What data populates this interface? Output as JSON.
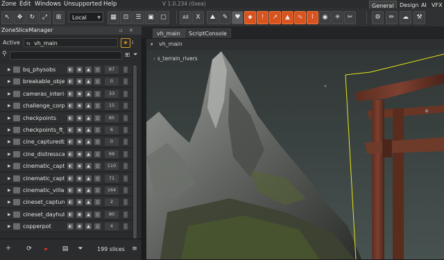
{
  "menu": [
    "Zone",
    "Edit",
    "Windows",
    "Unsupported",
    "Help"
  ],
  "version": "V 1.0.234 (0xea)",
  "workspace_tabs": [
    "General",
    "Design",
    "AI",
    "VFX"
  ],
  "coord_system": "Local",
  "toolbar_icons": [
    "select-icon",
    "move-icon",
    "rotate-icon",
    "scale-icon",
    "snap-icon",
    "all-icon",
    "x-axis-icon",
    "terrain-icon",
    "brush-icon",
    "paint-icon",
    "orange-tool-1-icon",
    "orange-tool-2-icon",
    "orange-tool-3-icon",
    "orange-tool-4-icon",
    "wave-icon",
    "path-icon",
    "camera-icon"
  ],
  "toolbar_labels": {
    "all": "All",
    "x": "X"
  },
  "panel": {
    "title": "ZoneSliceManager",
    "active_label": "Active",
    "active_value": "vh_main",
    "slice_count": "199 slices",
    "rows": [
      {
        "name": "bq_physobs",
        "count": "87"
      },
      {
        "name": "breakable_objec",
        "count": "0"
      },
      {
        "name": "cameras_interio",
        "count": "33"
      },
      {
        "name": "challenge_corps",
        "count": "15"
      },
      {
        "name": "checkpoints",
        "count": "85"
      },
      {
        "name": "checkpoints_ft_c",
        "count": "6"
      },
      {
        "name": "cine_capturedb",
        "count": "0"
      },
      {
        "name": "cine_distresscall",
        "count": "69"
      },
      {
        "name": "cinematic_captu",
        "count": "110"
      },
      {
        "name": "cinematic_captu",
        "count": "71"
      },
      {
        "name": "cinematic_villag",
        "count": "164"
      },
      {
        "name": "cineset_capture",
        "count": "2"
      },
      {
        "name": "cineset_dayhub",
        "count": "80"
      },
      {
        "name": "copperpot",
        "count": "4"
      }
    ]
  },
  "doc_tabs": [
    "vh_main",
    "ScriptConsole"
  ],
  "viewport": {
    "title": "vh_main",
    "layer_label": "s_terrain_rivers"
  },
  "colors": {
    "accent_orange": "#d9531e",
    "selection_yellow": "#e6e619"
  }
}
